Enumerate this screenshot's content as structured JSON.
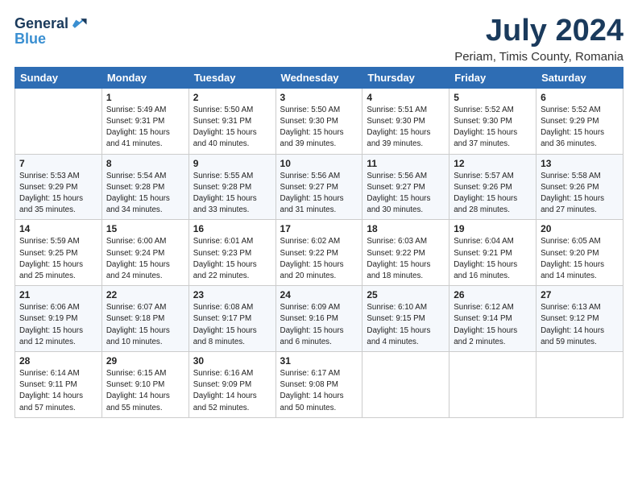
{
  "logo": {
    "general": "General",
    "blue": "Blue"
  },
  "title": "July 2024",
  "location": "Periam, Timis County, Romania",
  "days_of_week": [
    "Sunday",
    "Monday",
    "Tuesday",
    "Wednesday",
    "Thursday",
    "Friday",
    "Saturday"
  ],
  "weeks": [
    [
      {
        "day": "",
        "info": ""
      },
      {
        "day": "1",
        "info": "Sunrise: 5:49 AM\nSunset: 9:31 PM\nDaylight: 15 hours\nand 41 minutes."
      },
      {
        "day": "2",
        "info": "Sunrise: 5:50 AM\nSunset: 9:31 PM\nDaylight: 15 hours\nand 40 minutes."
      },
      {
        "day": "3",
        "info": "Sunrise: 5:50 AM\nSunset: 9:30 PM\nDaylight: 15 hours\nand 39 minutes."
      },
      {
        "day": "4",
        "info": "Sunrise: 5:51 AM\nSunset: 9:30 PM\nDaylight: 15 hours\nand 39 minutes."
      },
      {
        "day": "5",
        "info": "Sunrise: 5:52 AM\nSunset: 9:30 PM\nDaylight: 15 hours\nand 37 minutes."
      },
      {
        "day": "6",
        "info": "Sunrise: 5:52 AM\nSunset: 9:29 PM\nDaylight: 15 hours\nand 36 minutes."
      }
    ],
    [
      {
        "day": "7",
        "info": "Sunrise: 5:53 AM\nSunset: 9:29 PM\nDaylight: 15 hours\nand 35 minutes."
      },
      {
        "day": "8",
        "info": "Sunrise: 5:54 AM\nSunset: 9:28 PM\nDaylight: 15 hours\nand 34 minutes."
      },
      {
        "day": "9",
        "info": "Sunrise: 5:55 AM\nSunset: 9:28 PM\nDaylight: 15 hours\nand 33 minutes."
      },
      {
        "day": "10",
        "info": "Sunrise: 5:56 AM\nSunset: 9:27 PM\nDaylight: 15 hours\nand 31 minutes."
      },
      {
        "day": "11",
        "info": "Sunrise: 5:56 AM\nSunset: 9:27 PM\nDaylight: 15 hours\nand 30 minutes."
      },
      {
        "day": "12",
        "info": "Sunrise: 5:57 AM\nSunset: 9:26 PM\nDaylight: 15 hours\nand 28 minutes."
      },
      {
        "day": "13",
        "info": "Sunrise: 5:58 AM\nSunset: 9:26 PM\nDaylight: 15 hours\nand 27 minutes."
      }
    ],
    [
      {
        "day": "14",
        "info": "Sunrise: 5:59 AM\nSunset: 9:25 PM\nDaylight: 15 hours\nand 25 minutes."
      },
      {
        "day": "15",
        "info": "Sunrise: 6:00 AM\nSunset: 9:24 PM\nDaylight: 15 hours\nand 24 minutes."
      },
      {
        "day": "16",
        "info": "Sunrise: 6:01 AM\nSunset: 9:23 PM\nDaylight: 15 hours\nand 22 minutes."
      },
      {
        "day": "17",
        "info": "Sunrise: 6:02 AM\nSunset: 9:22 PM\nDaylight: 15 hours\nand 20 minutes."
      },
      {
        "day": "18",
        "info": "Sunrise: 6:03 AM\nSunset: 9:22 PM\nDaylight: 15 hours\nand 18 minutes."
      },
      {
        "day": "19",
        "info": "Sunrise: 6:04 AM\nSunset: 9:21 PM\nDaylight: 15 hours\nand 16 minutes."
      },
      {
        "day": "20",
        "info": "Sunrise: 6:05 AM\nSunset: 9:20 PM\nDaylight: 15 hours\nand 14 minutes."
      }
    ],
    [
      {
        "day": "21",
        "info": "Sunrise: 6:06 AM\nSunset: 9:19 PM\nDaylight: 15 hours\nand 12 minutes."
      },
      {
        "day": "22",
        "info": "Sunrise: 6:07 AM\nSunset: 9:18 PM\nDaylight: 15 hours\nand 10 minutes."
      },
      {
        "day": "23",
        "info": "Sunrise: 6:08 AM\nSunset: 9:17 PM\nDaylight: 15 hours\nand 8 minutes."
      },
      {
        "day": "24",
        "info": "Sunrise: 6:09 AM\nSunset: 9:16 PM\nDaylight: 15 hours\nand 6 minutes."
      },
      {
        "day": "25",
        "info": "Sunrise: 6:10 AM\nSunset: 9:15 PM\nDaylight: 15 hours\nand 4 minutes."
      },
      {
        "day": "26",
        "info": "Sunrise: 6:12 AM\nSunset: 9:14 PM\nDaylight: 15 hours\nand 2 minutes."
      },
      {
        "day": "27",
        "info": "Sunrise: 6:13 AM\nSunset: 9:12 PM\nDaylight: 14 hours\nand 59 minutes."
      }
    ],
    [
      {
        "day": "28",
        "info": "Sunrise: 6:14 AM\nSunset: 9:11 PM\nDaylight: 14 hours\nand 57 minutes."
      },
      {
        "day": "29",
        "info": "Sunrise: 6:15 AM\nSunset: 9:10 PM\nDaylight: 14 hours\nand 55 minutes."
      },
      {
        "day": "30",
        "info": "Sunrise: 6:16 AM\nSunset: 9:09 PM\nDaylight: 14 hours\nand 52 minutes."
      },
      {
        "day": "31",
        "info": "Sunrise: 6:17 AM\nSunset: 9:08 PM\nDaylight: 14 hours\nand 50 minutes."
      },
      {
        "day": "",
        "info": ""
      },
      {
        "day": "",
        "info": ""
      },
      {
        "day": "",
        "info": ""
      }
    ]
  ]
}
